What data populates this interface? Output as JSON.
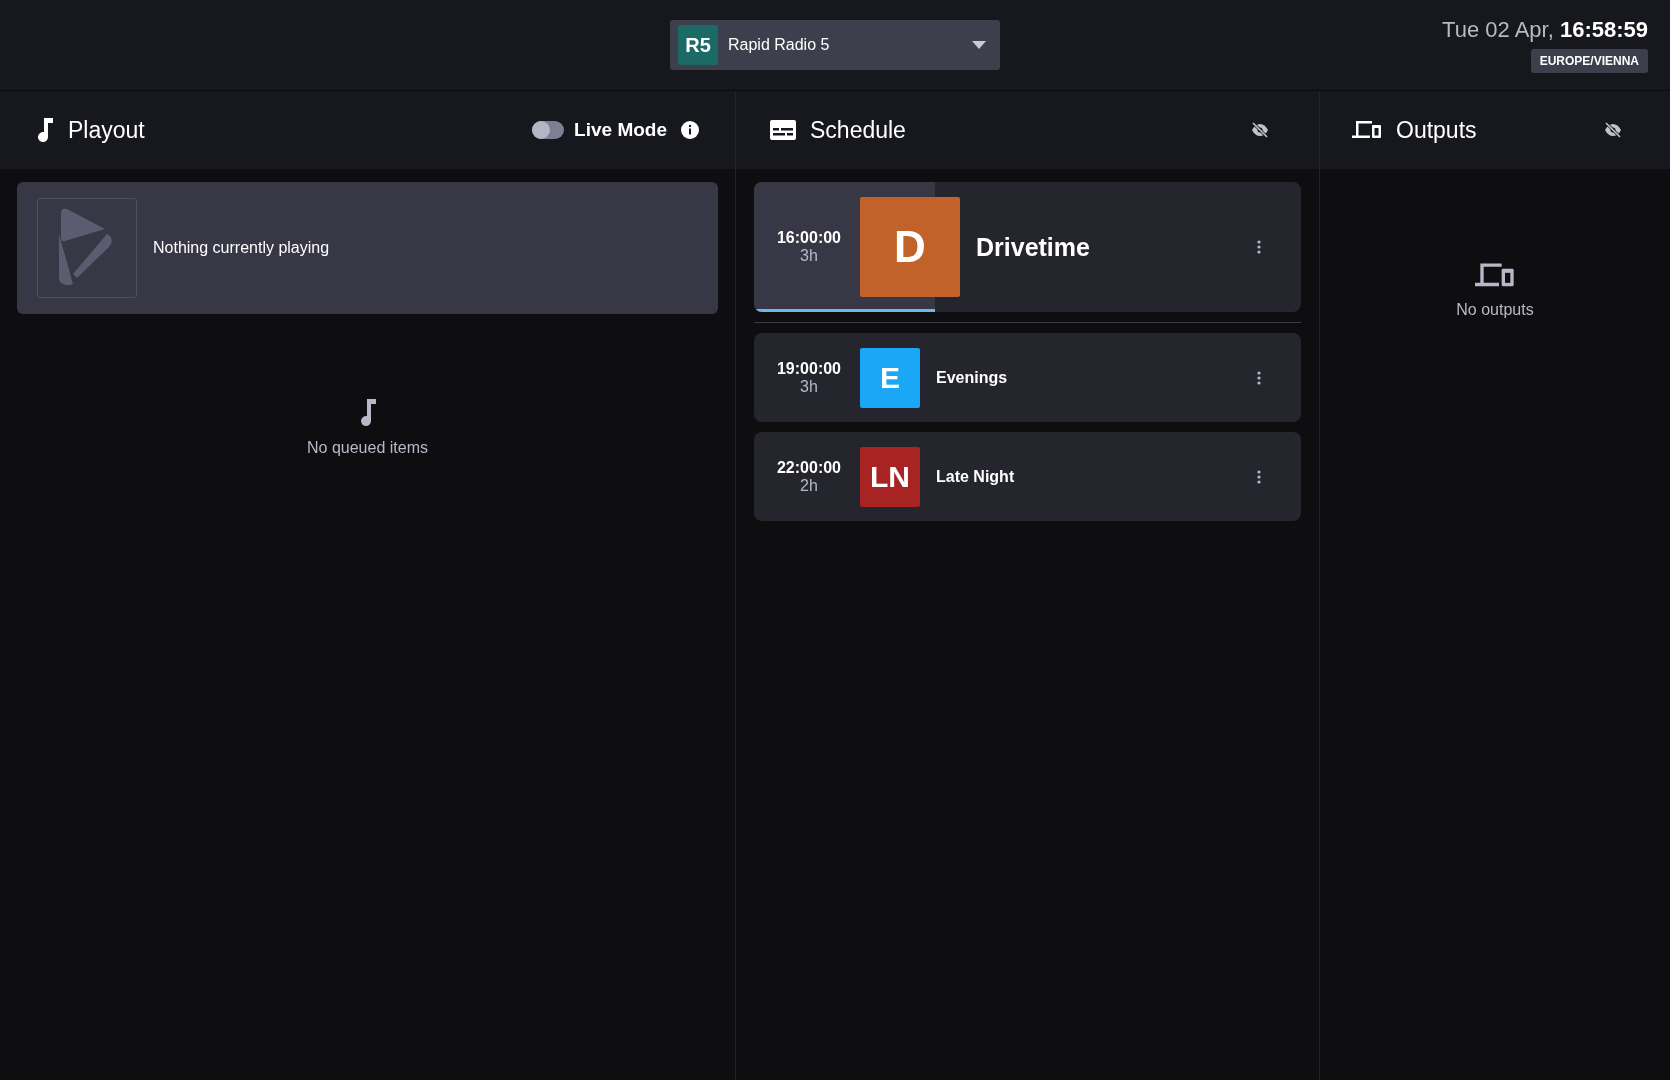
{
  "station_selector": {
    "badge": "R5",
    "name": "Rapid Radio 5"
  },
  "clock": {
    "date": "Tue 02 Apr,",
    "time": "16:58:59",
    "timezone": "EUROPE/VIENNA"
  },
  "playout": {
    "title": "Playout",
    "live_mode": {
      "label": "Live Mode",
      "on": false
    },
    "now_playing": "Nothing currently playing",
    "queue_empty": "No queued items"
  },
  "schedule": {
    "title": "Schedule",
    "items": [
      {
        "time": "16:00:00",
        "duration": "3h",
        "badge": "D",
        "name": "Drivetime",
        "color": "#c0622a",
        "current": true,
        "level": 0.33
      },
      {
        "time": "19:00:00",
        "duration": "3h",
        "badge": "E",
        "name": "Evenings",
        "color": "#1aa7f5",
        "current": false
      },
      {
        "time": "22:00:00",
        "duration": "2h",
        "badge": "LN",
        "name": "Late Night",
        "color": "#a82424",
        "current": false
      }
    ]
  },
  "outputs": {
    "title": "Outputs",
    "empty": "No outputs"
  }
}
